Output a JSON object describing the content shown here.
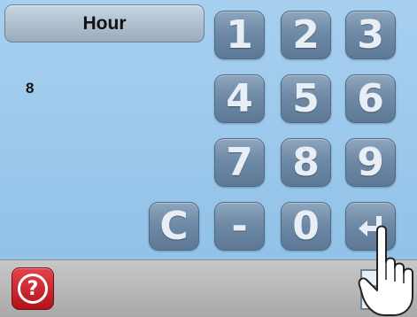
{
  "field": {
    "label": "Hour",
    "value": "8"
  },
  "keypad": [
    {
      "name": "key-1",
      "label": "1"
    },
    {
      "name": "key-2",
      "label": "2"
    },
    {
      "name": "key-3",
      "label": "3"
    },
    {
      "name": "key-4",
      "label": "4"
    },
    {
      "name": "key-5",
      "label": "5"
    },
    {
      "name": "key-6",
      "label": "6"
    },
    {
      "name": "key-7",
      "label": "7"
    },
    {
      "name": "key-8",
      "label": "8"
    },
    {
      "name": "key-9",
      "label": "9"
    },
    {
      "name": "clear-key",
      "label": "C"
    },
    {
      "name": "minus-key",
      "label": "-"
    },
    {
      "name": "key-0",
      "label": "0"
    },
    {
      "name": "enter-key",
      "label": "",
      "icon": "enter-arrow-icon"
    }
  ],
  "footer": {
    "help_icon": "question-icon",
    "document_icon": "document-icon"
  },
  "colors": {
    "background": "#9cc8ea",
    "key": "#6f8aa6",
    "help": "#c8161e",
    "footer": "#b8b8b8"
  }
}
